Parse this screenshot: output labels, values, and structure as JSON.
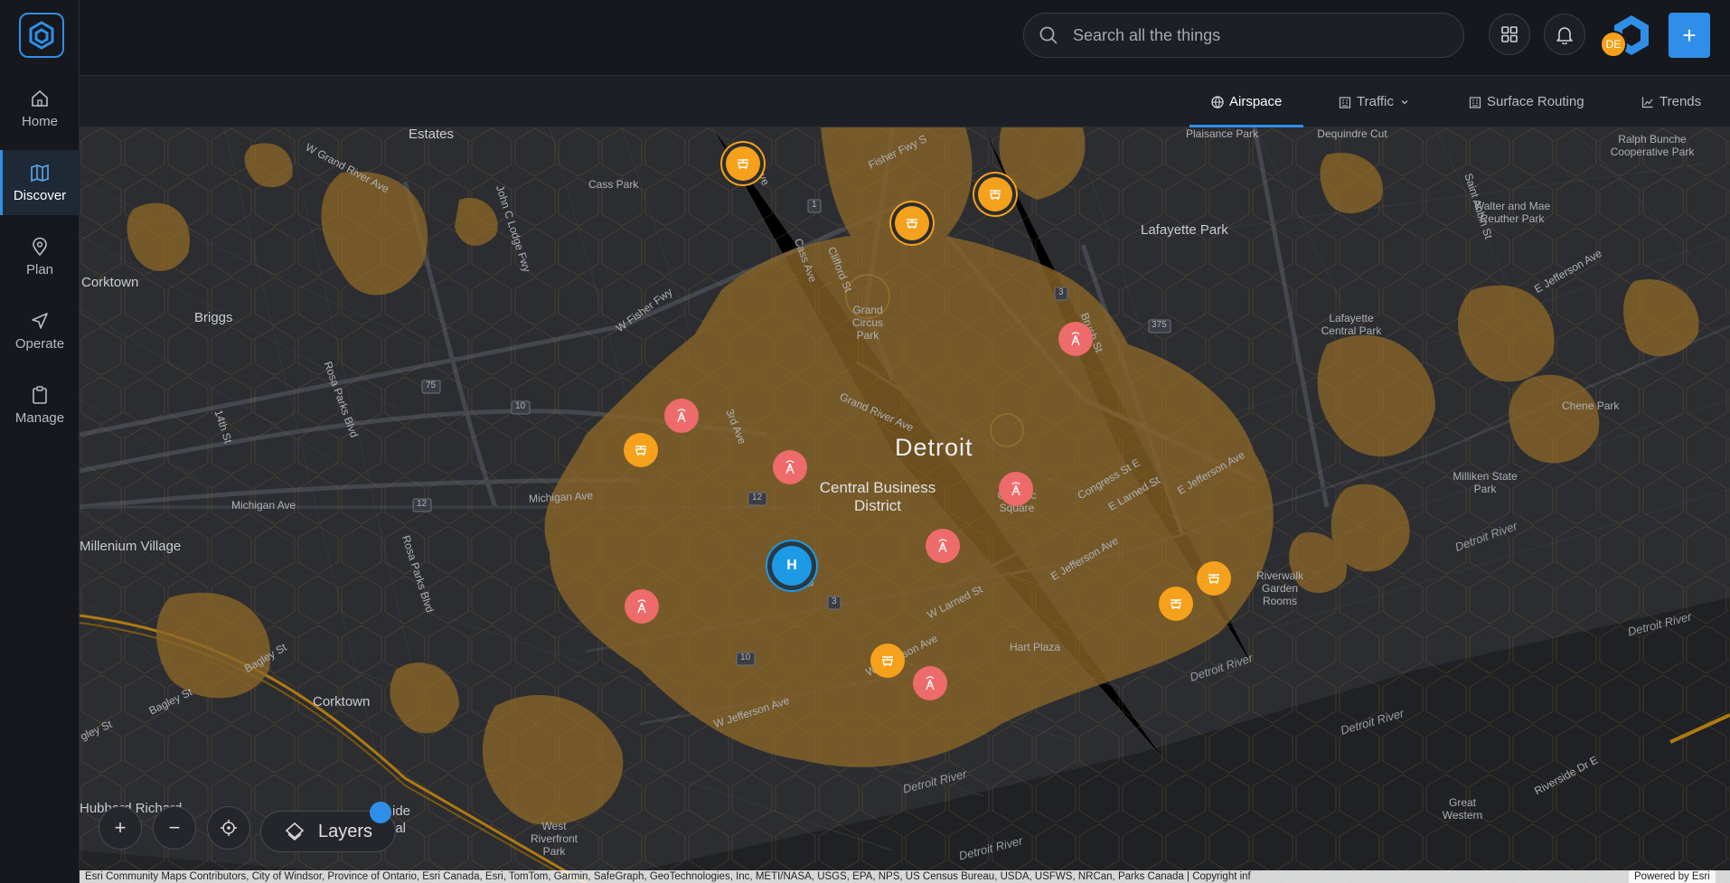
{
  "app": {
    "logo_icon": "hexagon-logo-icon",
    "accent": "#2f8fe8"
  },
  "sidebar": {
    "items": [
      {
        "label": "Home",
        "icon": "home-icon",
        "active": false
      },
      {
        "label": "Discover",
        "icon": "map-icon",
        "active": true
      },
      {
        "label": "Plan",
        "icon": "pin-icon",
        "active": false
      },
      {
        "label": "Operate",
        "icon": "send-icon",
        "active": false
      },
      {
        "label": "Manage",
        "icon": "clipboard-icon",
        "active": false
      }
    ]
  },
  "header": {
    "search_placeholder": "Search all the things",
    "avatar_initials": "DE",
    "add_label": "+"
  },
  "tabs": [
    {
      "label": "Airspace",
      "icon": "globe-icon",
      "active": true
    },
    {
      "label": "Traffic",
      "icon": "building-icon",
      "dropdown": true
    },
    {
      "label": "Surface Routing",
      "icon": "building-icon"
    },
    {
      "label": "Trends",
      "icon": "trend-icon"
    }
  ],
  "map": {
    "labels": {
      "estates": "Estates",
      "corktown_n": "Corktown",
      "briggs": "Briggs",
      "cass_park": "Cass Park",
      "lafayette_park": "Lafayette Park",
      "plaisance_park": "Plaisance Park",
      "dequindre_cut": "Dequindre Cut",
      "ralph_bunche": "Ralph Bunche Cooperative Park",
      "walter_reuther": "Walter and Mae Reuther Park",
      "lafayette_central": "Lafayette Central Park",
      "chene_park": "Chene Park",
      "millen_state": "Milliken State Park",
      "grand_circus": "Grand Circus Park",
      "detroit": "Detroit",
      "cbd": "Central Business District",
      "cadillac": "Cadillac Square",
      "hart_plaza": "Hart Plaza",
      "riverwalk": "Riverwalk Garden Rooms",
      "millenium_village": "Millenium Village",
      "corktown_s": "Corktown",
      "hubbard": "Hubbard Richard",
      "west_riverfront": "West Riverfront Park",
      "great_western": "Great Western",
      "ide": "ide",
      "ial": "ial",
      "w_grand_river": "W Grand River Ave",
      "john_lodge": "John C Lodge Fwy",
      "fisher_fwy": "Fisher Fwy S",
      "w_fisher_fwy": "W Fisher Fwy",
      "cass_ave_n": "Cass Ave",
      "cass_ave": "Cass Ave",
      "clifford": "Clifford St",
      "brush": "Brush St",
      "saint_aubin": "Saint Aubin St",
      "e_jefferson_ne": "E Jefferson Ave",
      "rosa_parks_n": "Rosa Parks Blvd",
      "rosa_parks_s": "Rosa Parks Blvd",
      "fourteenth": "14th St",
      "third_ave_n": "3rd Ave",
      "third_ave_s": "3rd Ave",
      "grand_river": "Grand River Ave",
      "michigan_w": "Michigan Ave",
      "michigan_e": "Michigan Ave",
      "congress": "Congress St E",
      "e_larned": "E Larned St",
      "e_jefferson_mid": "E Jefferson Ave",
      "e_jefferson_cbd": "E Jefferson Ave",
      "w_larned": "W Larned St",
      "w_jefferson": "W Jefferson Ave",
      "w_jefferson_s": "W Jefferson Ave",
      "bagley_n": "Bagley St",
      "bagley_s": "Bagley St",
      "gley": "gley St",
      "riverside": "Riverside Dr E",
      "detroit_river_1": "Detroit River",
      "detroit_river_2": "Detroit River",
      "detroit_river_3": "Detroit River",
      "detroit_river_4": "Detroit River",
      "detroit_river_5": "Detroit River",
      "detroit_river_6": "Detroit River",
      "rt1": "1",
      "rt3a": "3",
      "rt3b": "3",
      "rt375": "375",
      "rt75": "75",
      "rt10a": "10",
      "rt10b": "10",
      "rt12a": "12",
      "rt12b": "12"
    },
    "markers": [
      {
        "type": "drone",
        "ring": true,
        "icon": "drone-icon"
      },
      {
        "type": "drone",
        "ring": true,
        "icon": "drone-icon"
      },
      {
        "type": "drone",
        "ring": true,
        "icon": "drone-icon"
      },
      {
        "type": "drone",
        "ring": false,
        "icon": "drone-icon"
      },
      {
        "type": "drone",
        "ring": false,
        "icon": "drone-icon"
      },
      {
        "type": "drone",
        "ring": false,
        "icon": "drone-icon"
      },
      {
        "type": "drone",
        "ring": false,
        "icon": "drone-icon"
      },
      {
        "type": "tower",
        "icon": "radio-tower-icon"
      },
      {
        "type": "tower",
        "icon": "radio-tower-icon"
      },
      {
        "type": "tower",
        "icon": "radio-tower-icon"
      },
      {
        "type": "tower",
        "icon": "radio-tower-icon"
      },
      {
        "type": "tower",
        "icon": "radio-tower-icon"
      },
      {
        "type": "tower",
        "icon": "radio-tower-icon"
      },
      {
        "type": "heliport",
        "label": "H"
      }
    ],
    "controls": {
      "zoom_in": "+",
      "zoom_out": "−",
      "locate_icon": "crosshair-icon",
      "layers_label": "Layers"
    },
    "attribution": "Esri Community Maps Contributors, City of Windsor, Province of Ontario, Esri Canada, Esri, TomTom, Garmin, SafeGraph, GeoTechnologies, Inc, METI/NASA, USGS, EPA, NPS, US Census Bureau, USDA, USFWS, NRCan, Parks Canada | Copyright inf",
    "powered_by": "Powered by Esri"
  },
  "colors": {
    "hex_fill": "#8a6528",
    "drone": "#f5a11c",
    "tower": "#ee6b6b",
    "heliport": "#1d9ae6",
    "water": "#1f2124",
    "land": "#2b2d31"
  }
}
